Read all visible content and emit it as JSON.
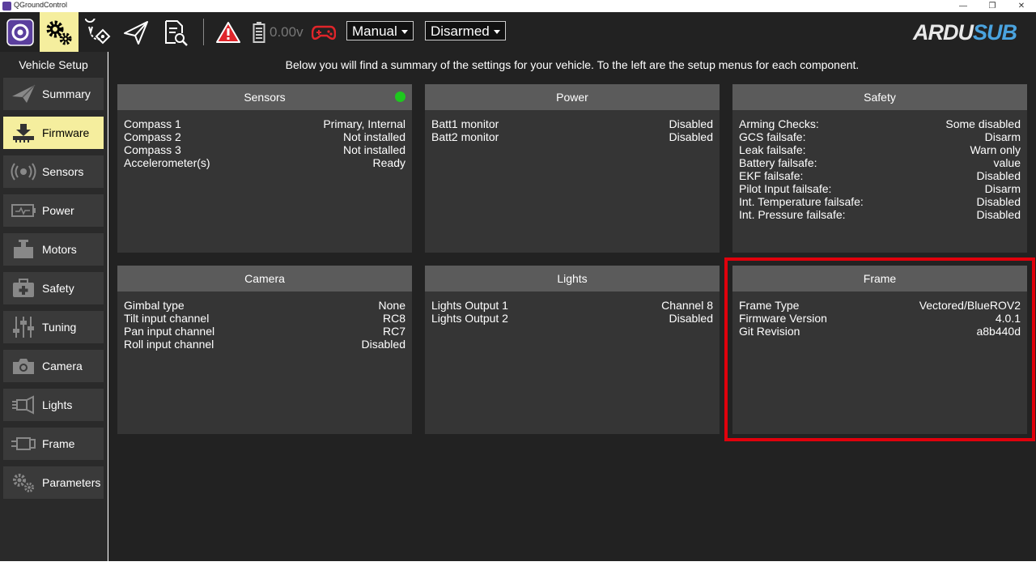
{
  "window": {
    "title": "QGroundControl",
    "controls": [
      "—",
      "❐",
      "✕"
    ]
  },
  "toolbar": {
    "battery_voltage": "0.00v",
    "flight_mode": "Manual",
    "arm_state": "Disarmed",
    "logo_ardu": "ARDU",
    "logo_sub": "SUB",
    "active_color": "#f5ee9e",
    "warning_color": "#e0252a"
  },
  "sidebar": {
    "title": "Vehicle Setup",
    "items": [
      {
        "label": "Summary",
        "icon": "paper-plane-icon"
      },
      {
        "label": "Firmware",
        "icon": "download-icon",
        "active": true
      },
      {
        "label": "Sensors",
        "icon": "radio-waves-icon"
      },
      {
        "label": "Power",
        "icon": "power-monitor-icon"
      },
      {
        "label": "Motors",
        "icon": "motor-icon"
      },
      {
        "label": "Safety",
        "icon": "first-aid-icon"
      },
      {
        "label": "Tuning",
        "icon": "sliders-icon"
      },
      {
        "label": "Camera",
        "icon": "camera-icon"
      },
      {
        "label": "Lights",
        "icon": "light-icon"
      },
      {
        "label": "Frame",
        "icon": "frame-icon"
      },
      {
        "label": "Parameters",
        "icon": "gears-icon"
      }
    ]
  },
  "main": {
    "header": "Below you will find a summary of the settings for your vehicle. To the left are the setup menus for each component."
  },
  "panels": {
    "sensors": {
      "title": "Sensors",
      "status_color": "#1ec81e",
      "rows": [
        {
          "label": "Compass 1",
          "value": "Primary, Internal"
        },
        {
          "label": "Compass 2",
          "value": "Not installed"
        },
        {
          "label": "Compass 3",
          "value": "Not installed"
        },
        {
          "label": "Accelerometer(s)",
          "value": "Ready"
        }
      ]
    },
    "power": {
      "title": "Power",
      "rows": [
        {
          "label": "Batt1 monitor",
          "value": "Disabled"
        },
        {
          "label": "Batt2 monitor",
          "value": "Disabled"
        }
      ]
    },
    "safety": {
      "title": "Safety",
      "rows": [
        {
          "label": "Arming Checks:",
          "value": "Some disabled"
        },
        {
          "label": "GCS failsafe:",
          "value": "Disarm"
        },
        {
          "label": "Leak failsafe:",
          "value": "Warn only"
        },
        {
          "label": "Battery failsafe:",
          "value": "value"
        },
        {
          "label": "EKF failsafe:",
          "value": "Disabled"
        },
        {
          "label": "Pilot Input failsafe:",
          "value": "Disarm"
        },
        {
          "label": "Int. Temperature failsafe:",
          "value": "Disabled"
        },
        {
          "label": "Int. Pressure failsafe:",
          "value": "Disabled"
        }
      ]
    },
    "camera": {
      "title": "Camera",
      "rows": [
        {
          "label": "Gimbal type",
          "value": "None"
        },
        {
          "label": "Tilt input channel",
          "value": "RC8"
        },
        {
          "label": "Pan input channel",
          "value": "RC7"
        },
        {
          "label": "Roll input channel",
          "value": "Disabled"
        }
      ]
    },
    "lights": {
      "title": "Lights",
      "rows": [
        {
          "label": "Lights Output 1",
          "value": "Channel 8"
        },
        {
          "label": "Lights Output 2",
          "value": "Disabled"
        }
      ]
    },
    "frame": {
      "title": "Frame",
      "highlight_color": "#e0000c",
      "rows": [
        {
          "label": "Frame Type",
          "value": "Vectored/BlueROV2"
        },
        {
          "label": "Firmware Version",
          "value": "4.0.1"
        },
        {
          "label": "Git Revision",
          "value": "a8b440d"
        }
      ]
    }
  }
}
